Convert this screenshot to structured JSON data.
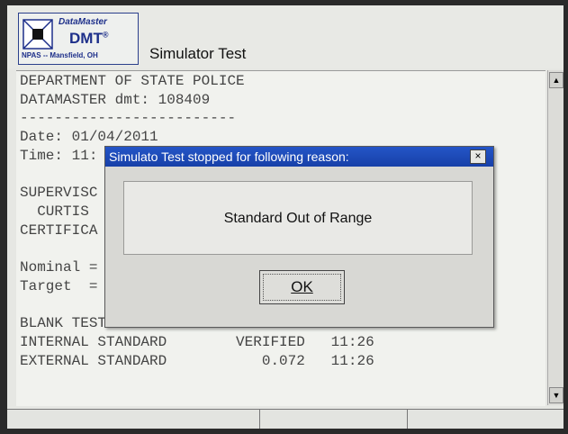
{
  "logo": {
    "brand_line1": "DataMaster",
    "brand_line2": "DMT",
    "brand_reg": "®",
    "location": "NPAS -- Mansfield, OH"
  },
  "window": {
    "title": "Simulator Test"
  },
  "report_lines": [
    "DEPARTMENT OF STATE POLICE",
    "DATAMASTER dmt: 108409",
    "-------------------------",
    "Date: 01/04/2011",
    "Time: 11:",
    "",
    "SUPERVISC",
    "  CURTIS",
    "CERTIFICA",
    "",
    "Nominal =",
    "Target  =",
    "",
    "BLANK TEST                  0.000   11:26",
    "INTERNAL STANDARD        VERIFIED   11:26",
    "EXTERNAL STANDARD           0.072   11:26"
  ],
  "scrollbar": {
    "up_icon": "triangle-up",
    "down_icon": "triangle-down"
  },
  "dialog": {
    "title": "Simulato Test stopped for following reason:",
    "close_label": "×",
    "message": "Standard Out of Range",
    "ok_label": "OK"
  }
}
